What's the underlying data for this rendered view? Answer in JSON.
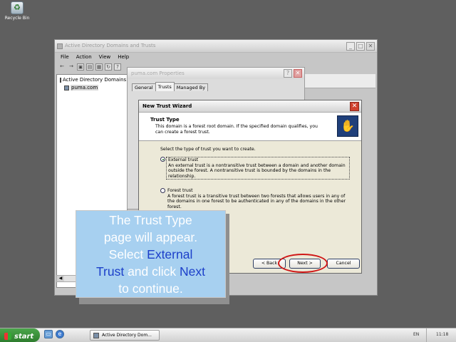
{
  "desktop": {
    "recycle_bin_label": "Recycle Bin"
  },
  "mmc": {
    "title": "Active Directory Domains and Trusts",
    "menu": [
      "File",
      "Action",
      "View",
      "Help"
    ],
    "tree": {
      "root": "Active Directory Domains and Trusts",
      "child": "puma.com"
    }
  },
  "properties": {
    "title": "puma.com Properties",
    "tabs": [
      "General",
      "Trusts",
      "Managed By"
    ],
    "help_glyph": "?",
    "close_glyph": "✕"
  },
  "wizard": {
    "title": "New Trust Wizard",
    "close_glyph": "✕",
    "header_title": "Trust Type",
    "header_desc": "This domain is a forest root domain. If the specified domain qualifies, you can create a forest trust.",
    "prompt": "Select the type of trust you want to create.",
    "options": [
      {
        "label": "External trust",
        "selected": true,
        "desc": "An external trust is a nontransitive trust between a domain and another domain outside the forest. A nontransitive trust is bounded by the domains in the relationship."
      },
      {
        "label": "Forest trust",
        "selected": false,
        "desc": "A forest trust is a transitive trust between two forests that allows users in any of the domains in one forest to be authenticated in any of the domains in the other forest."
      }
    ],
    "buttons": {
      "back": "< Back",
      "next": "Next >",
      "cancel": "Cancel"
    }
  },
  "callout": {
    "line1": "The Trust Type",
    "line2": "page will appear.",
    "line3_a": "Select ",
    "line3_b": "External",
    "line4_a": "Trust",
    "line4_b": " and click ",
    "line4_c": "Next",
    "line5": "to continue.",
    "text_color": "#ffffff",
    "highlight_color": "#1c3fc9",
    "background": "#a7d0f0"
  },
  "taskbar": {
    "start_label": "start",
    "task_label": "Active Directory Dom...",
    "language": "EN",
    "clock": "11:18"
  }
}
